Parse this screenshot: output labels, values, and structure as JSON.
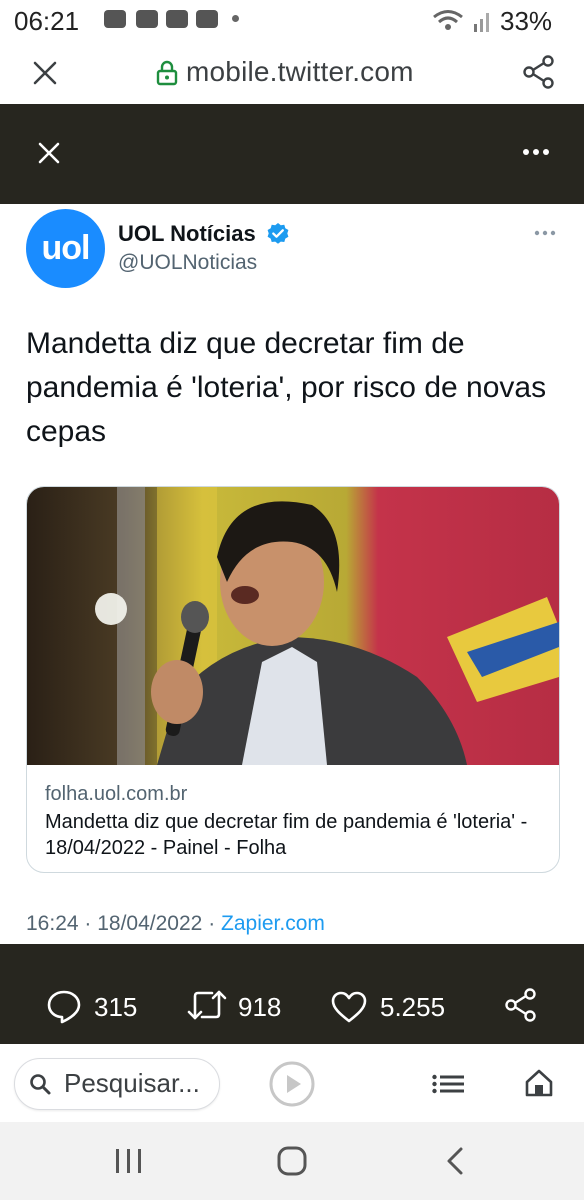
{
  "status_bar": {
    "time": "06:21",
    "battery": "33%"
  },
  "browser": {
    "url": "mobile.twitter.com",
    "search_placeholder": "Pesquisar..."
  },
  "tweet": {
    "author_name": "UOL Notícias",
    "author_handle": "@UOLNoticias",
    "avatar_text": "uol",
    "text": "Mandetta diz que decretar fim de pandemia é 'loteria', por risco de novas cepas",
    "card": {
      "domain": "folha.uol.com.br",
      "title": "Mandetta diz que decretar fim de pandemia é 'loteria' - 18/04/2022 - Painel - Folha"
    },
    "meta": {
      "time": "16:24",
      "date": "18/04/2022",
      "source": "Zapier.com"
    }
  },
  "actions": {
    "replies": "315",
    "retweets": "918",
    "likes": "5.255"
  },
  "colors": {
    "dark_overlay": "#27261f",
    "link_blue": "#1d9bf0",
    "avatar_blue": "#1a8cff",
    "secure_lock": "#1e8e3e"
  }
}
